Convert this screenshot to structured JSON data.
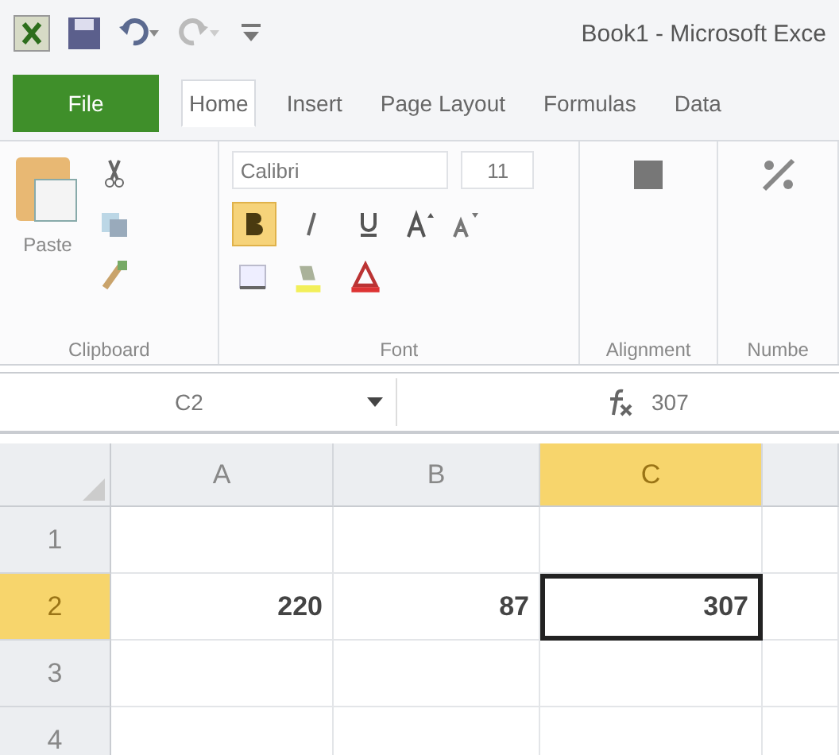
{
  "window": {
    "title": "Book1 - Microsoft Exce"
  },
  "tabs": [
    {
      "label": "File",
      "kind": "file",
      "selected": false
    },
    {
      "label": "Home",
      "kind": "tab",
      "selected": true
    },
    {
      "label": "Insert",
      "kind": "tab",
      "selected": false
    },
    {
      "label": "Page Layout",
      "kind": "tab",
      "selected": false
    },
    {
      "label": "Formulas",
      "kind": "tab",
      "selected": false
    },
    {
      "label": "Data",
      "kind": "tab",
      "selected": false
    }
  ],
  "clipboard": {
    "paste_label": "Paste",
    "group_label": "Clipboard"
  },
  "font": {
    "name": "Calibri",
    "size": "11",
    "bold": true,
    "italic": false,
    "underline": false,
    "group_label": "Font"
  },
  "alignment": {
    "group_label": "Alignment"
  },
  "number": {
    "group_label": "Numbe"
  },
  "formula_bar": {
    "name_box": "C2",
    "value": "307"
  },
  "sheet": {
    "columns": [
      {
        "label": "A",
        "selected": false
      },
      {
        "label": "B",
        "selected": false
      },
      {
        "label": "C",
        "selected": true
      }
    ],
    "rows": [
      {
        "header": "1",
        "selected": false
      },
      {
        "header": "2",
        "selected": true,
        "cells": [
          {
            "value": "220",
            "selected": false
          },
          {
            "value": "87",
            "selected": false
          },
          {
            "value": "307",
            "selected": true
          }
        ]
      },
      {
        "header": "3",
        "selected": false
      },
      {
        "header": "4",
        "selected": false
      }
    ]
  }
}
